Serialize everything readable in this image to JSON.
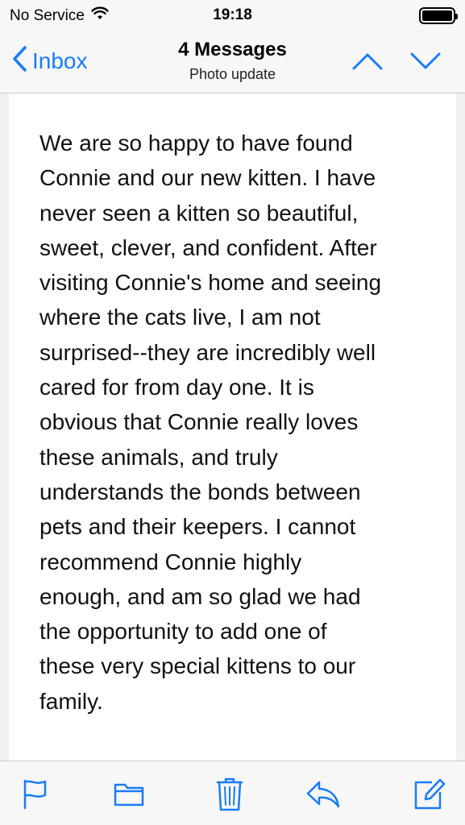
{
  "status_bar": {
    "carrier": "No Service",
    "time": "19:18",
    "icons": [
      "wifi-icon",
      "battery-icon"
    ]
  },
  "nav": {
    "back_label": "Inbox",
    "title": "4 Messages",
    "subtitle": "Photo update",
    "accent_color": "#1a7bf7",
    "icons": [
      "chevron-left-icon",
      "chevron-up-icon",
      "chevron-down-icon"
    ]
  },
  "message": {
    "body": "We are so happy to have found\nConnie and our new kitten. I have\nnever seen a kitten so beautiful,\nsweet, clever, and confident. After\nvisiting Connie's home and seeing\nwhere the cats live, I am not\nsurprised--they are incredibly well\ncared for from day one. It is\nobvious that Connie really loves\nthese animals, and truly\nunderstands the bonds between\npets and their keepers. I cannot\nrecommend Connie highly\nenough, and am so glad we had\nthe opportunity to add one of\nthese very special kittens to our\nfamily."
  },
  "toolbar": {
    "icons": [
      "flag-icon",
      "folder-icon",
      "trash-icon",
      "reply-icon",
      "compose-icon"
    ]
  }
}
